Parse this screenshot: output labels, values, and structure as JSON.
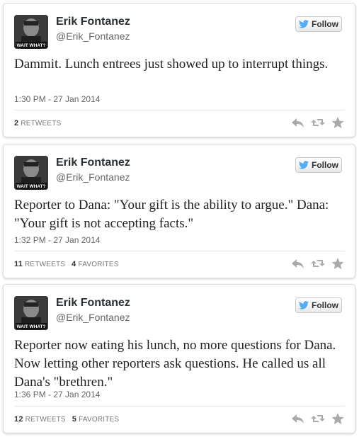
{
  "tweets": [
    {
      "name": "Erik Fontanez",
      "handle": "@Erik_Fontanez",
      "follow_label": "Follow",
      "avatar_caption": "WAIT WHAT?",
      "text": "Dammit. Lunch entrees just showed up to interrupt things.",
      "timestamp": "1:30 PM - 27 Jan 2014",
      "retweets_count": "2",
      "retweets_label": "RETWEETS",
      "favorites_count": "",
      "favorites_label": ""
    },
    {
      "name": "Erik Fontanez",
      "handle": "@Erik_Fontanez",
      "follow_label": "Follow",
      "avatar_caption": "WAIT WHAT?",
      "text": "Reporter to Dana: \"Your gift is the ability to argue.\" Dana: \"Your gift is not accepting facts.\"",
      "timestamp": "1:32 PM - 27 Jan 2014",
      "retweets_count": "11",
      "retweets_label": "RETWEETS",
      "favorites_count": "4",
      "favorites_label": "FAVORITES"
    },
    {
      "name": "Erik Fontanez",
      "handle": "@Erik_Fontanez",
      "follow_label": "Follow",
      "avatar_caption": "WAIT WHAT?",
      "text": "Reporter now eating his lunch, no more questions for Dana. Now letting other reporters ask questions. He called us all Dana's \"brethren.\"",
      "timestamp": "1:36 PM - 27 Jan 2014",
      "retweets_count": "12",
      "retweets_label": "RETWEETS",
      "favorites_count": "5",
      "favorites_label": "FAVORITES"
    }
  ],
  "icons": {
    "brand": "twitter-bird-icon",
    "reply": "reply-icon",
    "retweet": "retweet-icon",
    "favorite": "star-icon"
  },
  "colors": {
    "twitter_blue": "#55acee",
    "icon_gray": "#aaaaaa"
  }
}
